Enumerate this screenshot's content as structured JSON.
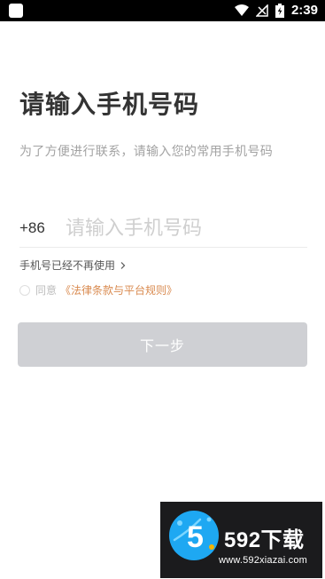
{
  "status_bar": {
    "time": "2:39"
  },
  "page": {
    "title": "请输入手机号码",
    "subtitle": "为了方便进行联系，请输入您的常用手机号码"
  },
  "phone": {
    "country_code": "+86",
    "placeholder": "请输入手机号码"
  },
  "links": {
    "unused_phone": "手机号已经不再使用"
  },
  "agreement": {
    "agree_label": "同意",
    "policy_label": "《法律条款与平台规则》"
  },
  "actions": {
    "next_label": "下一步"
  },
  "watermark": {
    "title": "592下载",
    "url": "www.592xiazai.com",
    "logo_digit": "5"
  },
  "icons": {
    "status_left": "app-square-icon",
    "wifi": "wifi-icon",
    "signal": "signal-icon",
    "battery": "battery-charging-icon",
    "chevron": "chevron-right-icon",
    "watermark_logo": "watermark-logo-icon"
  },
  "colors": {
    "title": "#333333",
    "subtitle": "#a3a3a3",
    "policy_link": "#d98a4f",
    "button_bg": "#cfd0d4",
    "status_bar": "#000000"
  }
}
